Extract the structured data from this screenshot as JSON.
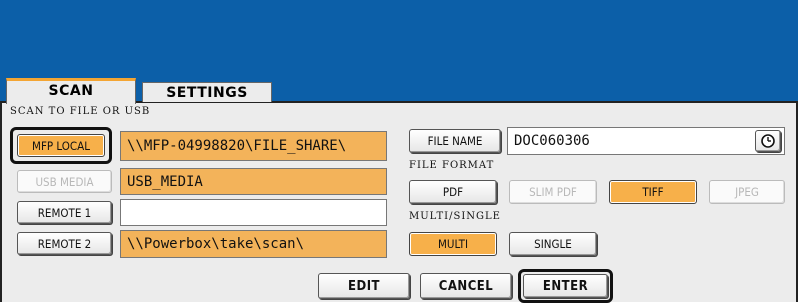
{
  "tabs": [
    {
      "label": "SCAN",
      "active": true
    },
    {
      "label": "SETTINGS",
      "active": false
    }
  ],
  "section_label": "SCAN TO FILE OR USB",
  "destinations": [
    {
      "label": "MFP LOCAL",
      "state": "selected",
      "path": "\\\\MFP-04998820\\FILE_SHARE\\"
    },
    {
      "label": "USB MEDIA",
      "state": "disabled",
      "path": "USB_MEDIA"
    },
    {
      "label": "REMOTE 1",
      "state": "normal",
      "path": ""
    },
    {
      "label": "REMOTE 2",
      "state": "normal",
      "path": "\\\\Powerbox\\take\\scan\\"
    }
  ],
  "file_name": {
    "button_label": "FILE NAME",
    "value": "DOC060306",
    "icon": "clock-icon"
  },
  "file_format": {
    "label": "FILE FORMAT",
    "options": [
      {
        "label": "PDF",
        "state": "normal"
      },
      {
        "label": "SLIM PDF",
        "state": "disabled"
      },
      {
        "label": "TIFF",
        "state": "selected"
      },
      {
        "label": "JPEG",
        "state": "disabled"
      }
    ]
  },
  "multi_single": {
    "label": "MULTI/SINGLE",
    "options": [
      {
        "label": "MULTI",
        "state": "selected"
      },
      {
        "label": "SINGLE",
        "state": "normal"
      }
    ]
  },
  "footer": {
    "edit_label": "EDIT",
    "cancel_label": "CANCEL",
    "enter_label": "ENTER"
  },
  "colors": {
    "header_blue": "#0c5fa8",
    "accent_orange": "#f4a533",
    "panel_gray": "#ececec"
  }
}
